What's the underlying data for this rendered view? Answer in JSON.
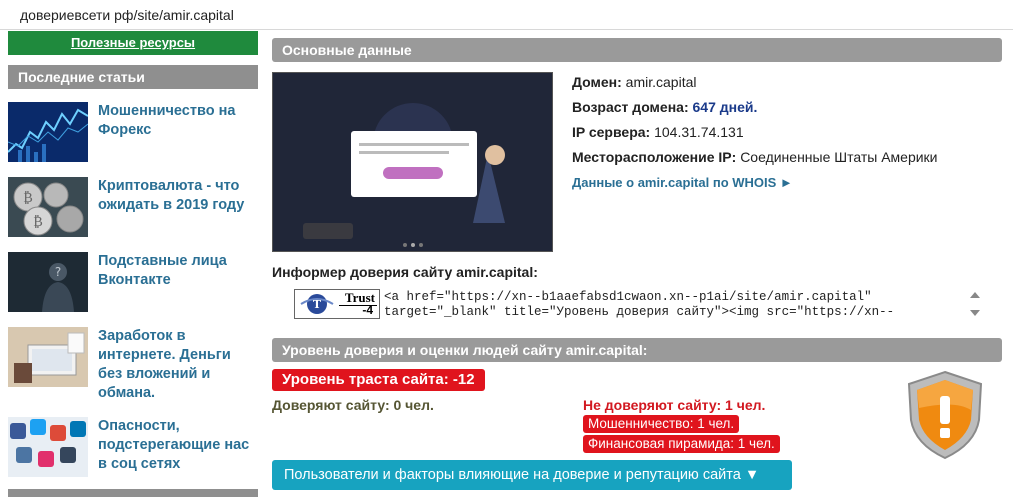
{
  "address_bar": {
    "url": "довериевсети рф/site/amir.capital"
  },
  "sidebar": {
    "resources_label": "Полезные ресурсы",
    "recent_header": "Последние статьи",
    "articles": [
      {
        "title": "Мошенничество на Форекс"
      },
      {
        "title": "Криптовалюта - что ожидать в 2019 году"
      },
      {
        "title": "Подставные лица Вконтакте"
      },
      {
        "title": "Заработок в интернете. Деньги без вложений и обмана."
      },
      {
        "title": "Опасности, подстерегающие нас в соц сетях"
      }
    ]
  },
  "main": {
    "basic_header": "Основные данные",
    "domain_label": "Домен:",
    "domain_value": "amir.capital",
    "age_label": "Возраст домена:",
    "age_value": "647 дней.",
    "ip_label": "IP сервера:",
    "ip_value": "104.31.74.131",
    "location_label": "Месторасположение IP:",
    "location_value": "Соединенные Штаты Америки",
    "whois_link": "Данные о amir.capital по WHOIS ►",
    "informer_title": "Информер доверия сайту amir.capital:",
    "badge_word": "Trust",
    "badge_value": "-4",
    "code_line1": "<a href=\"https://xn--b1aaefabsd1cwaon.xn--p1ai/site/amir.capital\"",
    "code_line2": "target=\"_blank\" title=\"Уровень доверия сайту\"><img src=\"https://xn--",
    "trust_header": "Уровень доверия и оценки людей сайту amir.capital:",
    "trust_level": "Уровень траста сайта: -12",
    "trust_yes": "Доверяют сайту: 0 чел.",
    "trust_no": "Не доверяют сайту: 1 чел.",
    "tags": [
      "Мошенничество: 1 чел.",
      "Финансовая пирамида: 1 чел."
    ],
    "factors_button": "Пользователи и факторы влияющие на доверие и репутацию сайта ▼"
  },
  "colors": {
    "accent_green": "#1f8a3d",
    "header_gray": "#9a9a9a",
    "link_blue": "#2a6f94",
    "danger_red": "#e0141d",
    "button_teal": "#17a3c0"
  },
  "icons": [
    "trust-logo-icon",
    "warning-shield-icon",
    "scroll-up-icon",
    "scroll-down-icon"
  ]
}
